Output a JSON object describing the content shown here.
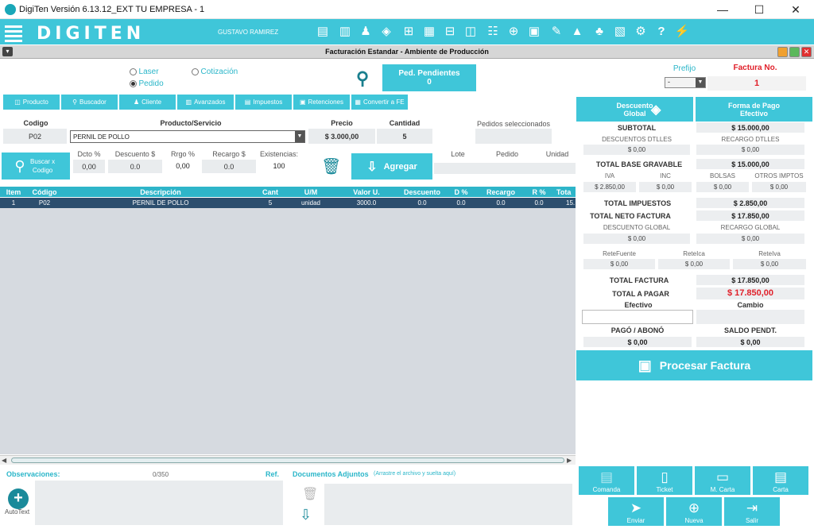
{
  "window": {
    "title": "DigiTen Versión 6.13.12_EXT TU EMPRESA - 1",
    "minimize": "—",
    "maximize": "☐",
    "close": "✕"
  },
  "header": {
    "logo": "DIGITEN",
    "user": "GUSTAVO RAMIREZ"
  },
  "form": {
    "title": "Facturación Estandar - Ambiente de Producción"
  },
  "doc_type": {
    "laser": "Laser",
    "cotizacion": "Cotización",
    "pedido": "Pedido",
    "selected": "Pedido"
  },
  "pendientes": {
    "label": "Ped. Pendientes",
    "count": "0"
  },
  "invoice": {
    "prefijo_label": "Prefijo",
    "prefijo_value": "-",
    "factura_label": "Factura No.",
    "factura_value": "1"
  },
  "toolbar": {
    "producto": "Producto",
    "buscador": "Buscador",
    "cliente": "Cliente",
    "avanzados": "Avanzados",
    "impuestos": "Impuestos",
    "retenciones": "Retenciones",
    "convertir": "Convertir a FE"
  },
  "entry": {
    "codigo_label": "Codigo",
    "producto_label": "Producto/Servicio",
    "precio_label": "Precio",
    "cantidad_label": "Cantidad",
    "pedidos_sel_label": "Pedidos seleccionados",
    "codigo": "P02",
    "producto": "PERNIL DE POLLO",
    "precio": "$ 3.000,00",
    "cantidad": "5",
    "buscar_label": "Buscar x Codigo",
    "dcto_label": "Dcto %",
    "descuento_label": "Descuento $",
    "rrgo_label": "Rrgo %",
    "recargo_label": "Recargo $",
    "exist_label": "Existencias:",
    "dcto": "0,00",
    "descuento": "0.0",
    "rrgo": "0,00",
    "recargo": "0.0",
    "existencias": "100",
    "agregar": "Agregar",
    "lote_label": "Lote",
    "pedido_label": "Pedido",
    "unidad_label": "Unidad"
  },
  "grid": {
    "headers": [
      "Item",
      "Código",
      "Descripción",
      "Cant",
      "U/M",
      "Valor U.",
      "Descuento",
      "D %",
      "Recargo",
      "R %",
      "Tota"
    ],
    "rows": [
      [
        "1",
        "P02",
        "PERNIL DE POLLO",
        "5",
        "unidad",
        "3000.0",
        "0.0",
        "0.0",
        "0.0",
        "0.0",
        "15."
      ]
    ]
  },
  "bottom": {
    "observaciones": "Observaciones:",
    "obs_count": "0/350",
    "ref": "Ref.",
    "documentos": "Documentos Adjuntos",
    "documentos_hint": "(Arrastre el archivo y suelta aquí)",
    "autotext": "AutoText"
  },
  "summary": {
    "descuento_global_btn": "Descuento Global",
    "forma_pago_btn": "Forma de Pago Efectivo",
    "subtotal_label": "SUBTOTAL",
    "subtotal": "$ 15.000,00",
    "desc_dtlles_label": "DESCUENTOS DTLLES",
    "desc_dtlles": "$ 0,00",
    "rec_dtlles_label": "RECARGO DTLLES",
    "rec_dtlles": "$ 0,00",
    "base_gravable_label": "TOTAL BASE GRAVABLE",
    "base_gravable": "$ 15.000,00",
    "iva_label": "IVA",
    "iva": "$ 2.850,00",
    "inc_label": "INC",
    "inc": "$ 0,00",
    "bolsas_label": "BOLSAS",
    "bolsas": "$ 0,00",
    "otros_label": "OTROS IMPTOS",
    "otros": "$ 0,00",
    "total_impuestos_label": "TOTAL IMPUESTOS",
    "total_impuestos": "$ 2.850,00",
    "neto_label": "TOTAL NETO FACTURA",
    "neto": "$ 17.850,00",
    "desc_global_label": "DESCUENTO GLOBAL",
    "desc_global": "$ 0,00",
    "rec_global_label": "RECARGO GLOBAL",
    "rec_global": "$ 0,00",
    "retefuente_label": "ReteFuente",
    "retefuente": "$ 0,00",
    "reteica_label": "ReteIca",
    "reteica": "$ 0,00",
    "reteiva_label": "ReteIva",
    "reteiva": "$ 0,00",
    "total_factura_label": "TOTAL FACTURA",
    "total_factura": "$ 17.850,00",
    "total_pagar_label": "TOTAL A PAGAR",
    "total_pagar": "$ 17.850,00",
    "efectivo_label": "Efectivo",
    "cambio_label": "Cambio",
    "pago_label": "PAGÓ / ABONÓ",
    "pago": "$ 0,00",
    "saldo_label": "SALDO PENDT.",
    "saldo": "$ 0,00",
    "procesar": "Procesar Factura"
  },
  "actions": {
    "comanda": "Comanda",
    "ticket": "Ticket",
    "mcarta": "M. Carta",
    "carta": "Carta",
    "enviar": "Enviar",
    "nueva": "Nueva",
    "salir": "Salir"
  },
  "colors": {
    "teal": "#3fc6d9",
    "dark_row": "#2c4e6e",
    "red": "#e0202a"
  }
}
